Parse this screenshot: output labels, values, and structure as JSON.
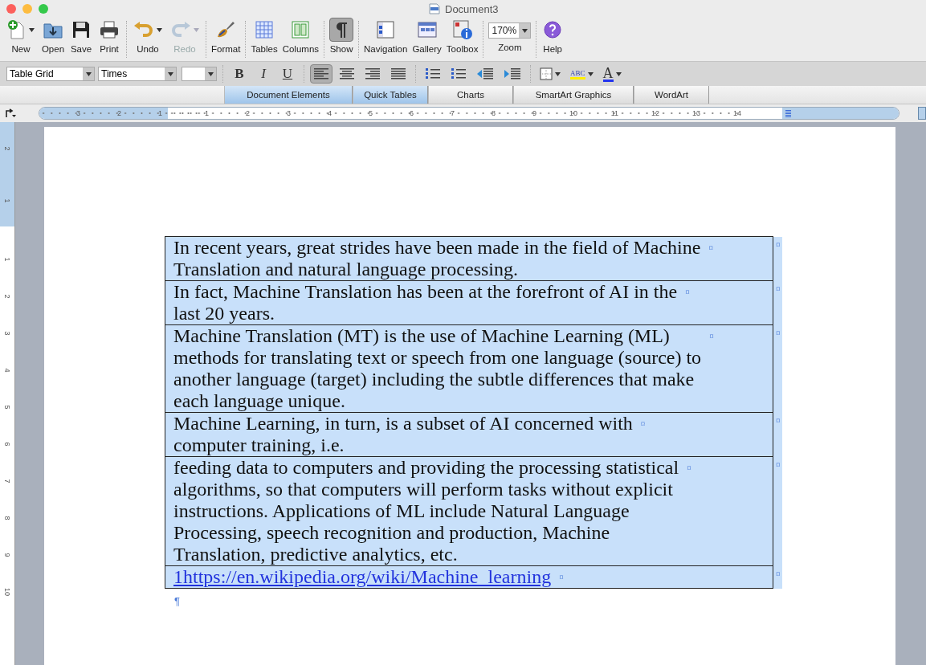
{
  "window": {
    "title": "Document3"
  },
  "toolbar": [
    {
      "label": "New",
      "kind": "new",
      "selected": false,
      "disabled": false
    },
    {
      "label": "Open",
      "kind": "open",
      "selected": false,
      "disabled": false
    },
    {
      "label": "Save",
      "kind": "save",
      "selected": false,
      "disabled": false
    },
    {
      "label": "Print",
      "kind": "print",
      "selected": false,
      "disabled": false
    },
    {
      "label": "Undo",
      "kind": "undo",
      "selected": false,
      "disabled": false
    },
    {
      "label": "Redo",
      "kind": "redo",
      "selected": false,
      "disabled": true
    },
    {
      "label": "Format",
      "kind": "format",
      "selected": false,
      "disabled": false
    },
    {
      "label": "Tables",
      "kind": "tables",
      "selected": false,
      "disabled": false
    },
    {
      "label": "Columns",
      "kind": "columns",
      "selected": false,
      "disabled": false
    },
    {
      "label": "Show",
      "kind": "show",
      "selected": true,
      "disabled": false
    },
    {
      "label": "Navigation",
      "kind": "navigation",
      "selected": false,
      "disabled": false
    },
    {
      "label": "Gallery",
      "kind": "gallery",
      "selected": false,
      "disabled": false
    },
    {
      "label": "Toolbox",
      "kind": "toolbox",
      "selected": false,
      "disabled": false
    }
  ],
  "zoom": {
    "value": "170%",
    "label": "Zoom"
  },
  "help": {
    "label": "Help"
  },
  "format_bar": {
    "style": "Table Grid",
    "font": "Times",
    "buttons": [
      {
        "kind": "bold",
        "text": "B",
        "selected": false
      },
      {
        "kind": "italic",
        "text": "I",
        "selected": false
      },
      {
        "kind": "underline",
        "text": "U",
        "selected": false
      },
      {
        "kind": "align-left",
        "selected": true
      },
      {
        "kind": "align-center",
        "selected": false
      },
      {
        "kind": "align-right",
        "selected": false
      },
      {
        "kind": "justify",
        "selected": false
      },
      {
        "kind": "numbered-list",
        "selected": false
      },
      {
        "kind": "bullet-list",
        "selected": false
      },
      {
        "kind": "outdent",
        "selected": false
      },
      {
        "kind": "indent",
        "selected": false
      }
    ],
    "highlight_text": "ABC",
    "font_color_text": "A"
  },
  "ribbon_tabs": [
    {
      "label": "Document Elements",
      "selected": true
    },
    {
      "label": "Quick Tables",
      "selected": true
    },
    {
      "label": "Charts",
      "selected": false
    },
    {
      "label": "SmartArt Graphics",
      "selected": false
    },
    {
      "label": "WordArt",
      "selected": false
    }
  ],
  "ruler": {
    "left_numbers": [
      "3",
      "2",
      "1"
    ],
    "numbers": [
      "1",
      "2",
      "3",
      "4",
      "5",
      "6",
      "7",
      "8",
      "9",
      "10",
      "11",
      "12",
      "13",
      "14"
    ]
  },
  "vertical_ruler": {
    "top_numbers": [
      "2",
      "1"
    ],
    "numbers": [
      "1",
      "2",
      "3",
      "4",
      "5",
      "6",
      "7",
      "8",
      "9",
      "10"
    ]
  },
  "table": {
    "rows": [
      {
        "kind": "text",
        "lines": [
          "In recent years, great strides have been made in the field of Machine",
          "Translation and natural language processing."
        ],
        "cell_mark": "¤",
        "row_mark": "¤"
      },
      {
        "kind": "text",
        "lines": [
          "In fact, Machine Translation has been at the forefront of AI in the",
          "last 20 years."
        ],
        "cell_mark": "¤",
        "row_mark": "¤"
      },
      {
        "kind": "text",
        "lines": [
          "Machine Translation (MT) is the use of Machine Learning (ML)",
          "methods for translating text or speech from one language (source) to",
          "another language (target) including the subtle differences that make",
          "each language unique."
        ],
        "cell_mark": "¤",
        "row_mark": "¤"
      },
      {
        "kind": "text",
        "lines": [
          "Machine Learning, in turn, is a subset of AI concerned with",
          "computer training, i.e."
        ],
        "cell_mark": "¤",
        "row_mark": "¤"
      },
      {
        "kind": "text",
        "lines": [
          "feeding data to computers and providing the processing statistical",
          "algorithms, so that computers will perform tasks without explicit",
          "instructions. Applications of ML include Natural Language",
          "Processing, speech recognition and production, Machine",
          "Translation, predictive analytics, etc."
        ],
        "cell_mark": "¤",
        "row_mark": "¤"
      },
      {
        "kind": "link",
        "lines": [
          "1https://en.wikipedia.org/wiki/Machine_learning"
        ],
        "cell_mark": "¤",
        "row_mark": "¤"
      }
    ]
  },
  "paragraph_mark": "¶"
}
